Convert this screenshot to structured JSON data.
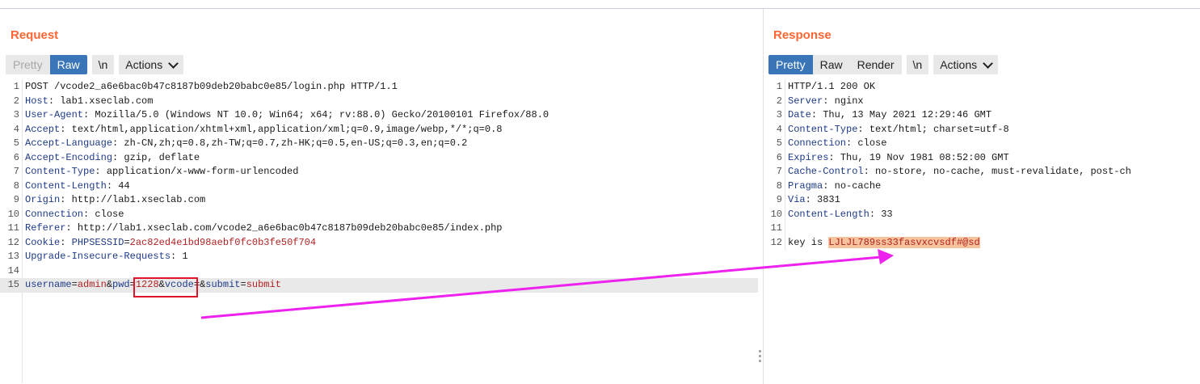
{
  "request": {
    "title": "Request",
    "toolbar": {
      "pretty": "Pretty",
      "raw": "Raw",
      "newline": "\\n",
      "actions": "Actions"
    },
    "lines": [
      {
        "n": "1",
        "parts": [
          {
            "t": "POST /vcode2_a6e6bac0b47c8187b09deb20babc0e85/login.php HTTP/1.1",
            "c": ""
          }
        ]
      },
      {
        "n": "2",
        "parts": [
          {
            "t": "Host",
            "c": "hname"
          },
          {
            "t": ": lab1.xseclab.com",
            "c": ""
          }
        ]
      },
      {
        "n": "3",
        "parts": [
          {
            "t": "User-Agent",
            "c": "hname"
          },
          {
            "t": ": Mozilla/5.0 (Windows NT 10.0; Win64; x64; rv:88.0) Gecko/20100101 Firefox/88.0",
            "c": ""
          }
        ]
      },
      {
        "n": "4",
        "parts": [
          {
            "t": "Accept",
            "c": "hname"
          },
          {
            "t": ": text/html,application/xhtml+xml,application/xml;q=0.9,image/webp,*/*;q=0.8",
            "c": ""
          }
        ]
      },
      {
        "n": "5",
        "parts": [
          {
            "t": "Accept-Language",
            "c": "hname"
          },
          {
            "t": ": zh-CN,zh;q=0.8,zh-TW;q=0.7,zh-HK;q=0.5,en-US;q=0.3,en;q=0.2",
            "c": ""
          }
        ]
      },
      {
        "n": "6",
        "parts": [
          {
            "t": "Accept-Encoding",
            "c": "hname"
          },
          {
            "t": ": gzip, deflate",
            "c": ""
          }
        ]
      },
      {
        "n": "7",
        "parts": [
          {
            "t": "Content-Type",
            "c": "hname"
          },
          {
            "t": ": application/x-www-form-urlencoded",
            "c": ""
          }
        ]
      },
      {
        "n": "8",
        "parts": [
          {
            "t": "Content-Length",
            "c": "hname"
          },
          {
            "t": ": 44",
            "c": ""
          }
        ]
      },
      {
        "n": "9",
        "parts": [
          {
            "t": "Origin",
            "c": "hname"
          },
          {
            "t": ": http://lab1.xseclab.com",
            "c": ""
          }
        ]
      },
      {
        "n": "10",
        "parts": [
          {
            "t": "Connection",
            "c": "hname"
          },
          {
            "t": ": close",
            "c": ""
          }
        ]
      },
      {
        "n": "11",
        "parts": [
          {
            "t": "Referer",
            "c": "hname"
          },
          {
            "t": ": http://lab1.xseclab.com/vcode2_a6e6bac0b47c8187b09deb20babc0e85/index.php",
            "c": ""
          }
        ]
      },
      {
        "n": "12",
        "parts": [
          {
            "t": "Cookie",
            "c": "hname"
          },
          {
            "t": ": ",
            "c": ""
          },
          {
            "t": "PHPSESSID",
            "c": "param"
          },
          {
            "t": "=",
            "c": ""
          },
          {
            "t": "2ac82ed4e1bd98aebf0fc0b3fe50f704",
            "c": "val"
          }
        ]
      },
      {
        "n": "13",
        "parts": [
          {
            "t": "Upgrade-Insecure-Requests",
            "c": "hname"
          },
          {
            "t": ": 1",
            "c": ""
          }
        ]
      },
      {
        "n": "14",
        "parts": []
      },
      {
        "n": "15",
        "hl": true,
        "parts": [
          {
            "t": "username",
            "c": "param"
          },
          {
            "t": "=",
            "c": ""
          },
          {
            "t": "admin",
            "c": "val"
          },
          {
            "t": "&",
            "c": ""
          },
          {
            "t": "pwd",
            "c": "param"
          },
          {
            "t": "=",
            "c": ""
          },
          {
            "t": "1228",
            "c": "val"
          },
          {
            "t": "&",
            "c": ""
          },
          {
            "t": "vcode",
            "c": "param"
          },
          {
            "t": "=&",
            "c": ""
          },
          {
            "t": "submit",
            "c": "param"
          },
          {
            "t": "=",
            "c": ""
          },
          {
            "t": "submit",
            "c": "val"
          }
        ]
      }
    ]
  },
  "response": {
    "title": "Response",
    "toolbar": {
      "pretty": "Pretty",
      "raw": "Raw",
      "render": "Render",
      "newline": "\\n",
      "actions": "Actions"
    },
    "lines": [
      {
        "n": "1",
        "parts": [
          {
            "t": "HTTP/1.1 200 OK",
            "c": ""
          }
        ]
      },
      {
        "n": "2",
        "parts": [
          {
            "t": "Server",
            "c": "hname"
          },
          {
            "t": ": nginx",
            "c": ""
          }
        ]
      },
      {
        "n": "3",
        "parts": [
          {
            "t": "Date",
            "c": "hname"
          },
          {
            "t": ": Thu, 13 May 2021 12:29:46 GMT",
            "c": ""
          }
        ]
      },
      {
        "n": "4",
        "parts": [
          {
            "t": "Content-Type",
            "c": "hname"
          },
          {
            "t": ": text/html; charset=utf-8",
            "c": ""
          }
        ]
      },
      {
        "n": "5",
        "parts": [
          {
            "t": "Connection",
            "c": "hname"
          },
          {
            "t": ": close",
            "c": ""
          }
        ]
      },
      {
        "n": "6",
        "parts": [
          {
            "t": "Expires",
            "c": "hname"
          },
          {
            "t": ": Thu, 19 Nov 1981 08:52:00 GMT",
            "c": ""
          }
        ]
      },
      {
        "n": "7",
        "parts": [
          {
            "t": "Cache-Control",
            "c": "hname"
          },
          {
            "t": ": no-store, no-cache, must-revalidate, post-ch",
            "c": ""
          }
        ]
      },
      {
        "n": "8",
        "parts": [
          {
            "t": "Pragma",
            "c": "hname"
          },
          {
            "t": ": no-cache",
            "c": ""
          }
        ]
      },
      {
        "n": "9",
        "parts": [
          {
            "t": "Via",
            "c": "hname"
          },
          {
            "t": ": 3831",
            "c": ""
          }
        ]
      },
      {
        "n": "10",
        "parts": [
          {
            "t": "Content-Length",
            "c": "hname"
          },
          {
            "t": ": 33",
            "c": ""
          }
        ]
      },
      {
        "n": "11",
        "parts": []
      },
      {
        "n": "12",
        "parts": [
          {
            "t": "key is ",
            "c": ""
          },
          {
            "t": "LJLJL789ss33fasvxcvsdf#@sd",
            "c": "key-hl"
          }
        ]
      }
    ]
  },
  "colors": {
    "title": "#ff6633",
    "active_tab": "#3a75b8",
    "annotation_arrow": "#ee22ee",
    "annotation_box": "#e0142c"
  }
}
